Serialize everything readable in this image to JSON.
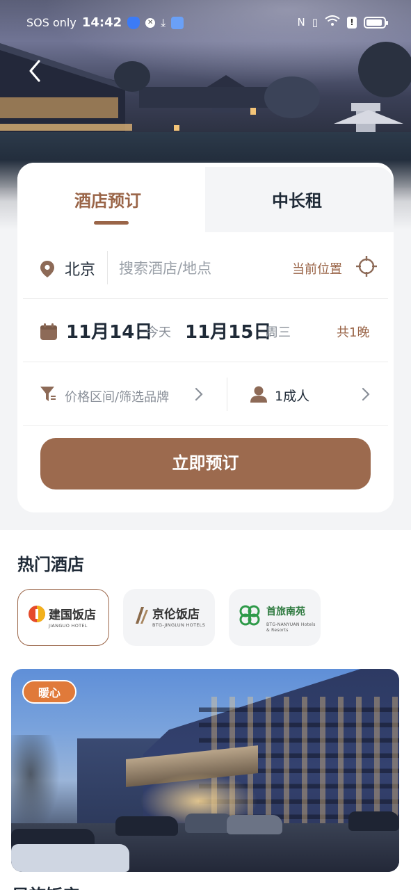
{
  "status_bar": {
    "carrier": "SOS only",
    "time": "14:42"
  },
  "tabs": [
    {
      "label": "酒店预订",
      "active": true
    },
    {
      "label": "中长租",
      "active": false
    }
  ],
  "search": {
    "city": "北京",
    "placeholder": "搜索酒店/地点",
    "current_location_label": "当前位置"
  },
  "dates": {
    "check_in": "11月14日",
    "check_in_day": "今天",
    "check_out": "11月15日",
    "check_out_day": "周三",
    "nights": "共1晚"
  },
  "filters": {
    "price_brand": "价格区间/筛选品牌",
    "guests": "1成人"
  },
  "book_button": "立即预订",
  "hot_hotels": {
    "title": "热门酒店",
    "brands": [
      {
        "name": "建国饭店",
        "sub": "JIANGUO HOTEL",
        "selected": true
      },
      {
        "name": "京伦饭店",
        "sub": "BTG-JINGLUN HOTELS",
        "selected": false
      },
      {
        "name": "首旅南苑",
        "sub": "BTG-NANYUAN Hotels & Resorts",
        "selected": false
      }
    ],
    "badge": "暖心"
  },
  "next_section_title": "民族饭店",
  "colors": {
    "accent": "#9a6548",
    "button": "#9c6a4e",
    "badge": "#e07a3a"
  }
}
